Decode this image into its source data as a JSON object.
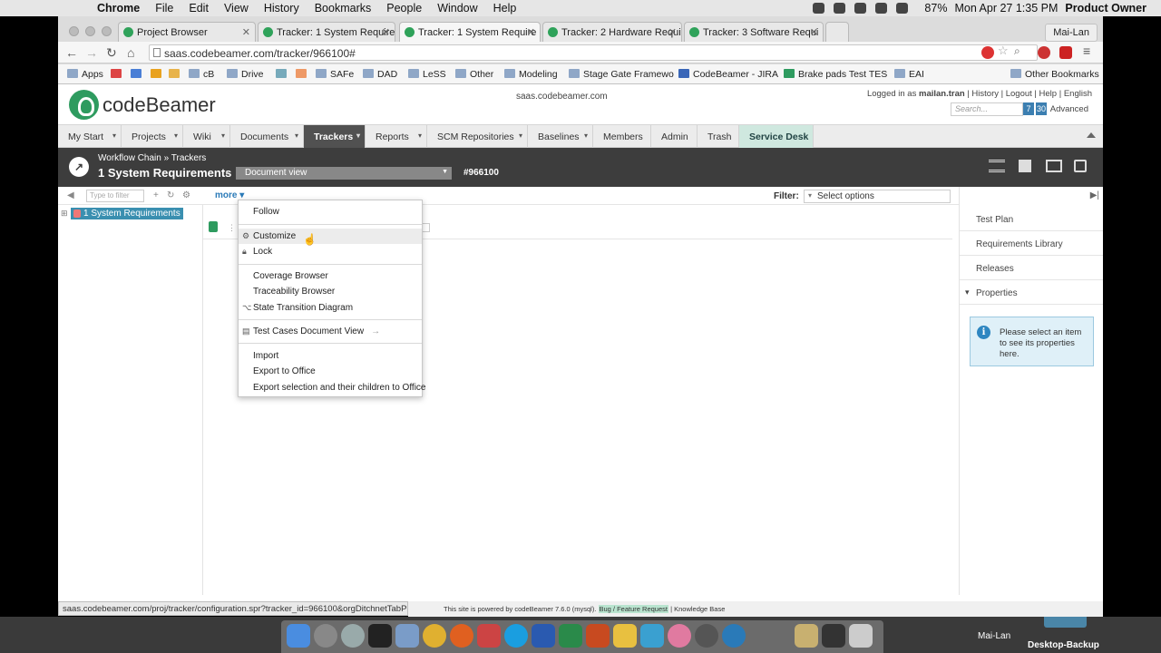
{
  "mac_menubar": {
    "app": "Chrome",
    "menus": [
      "File",
      "Edit",
      "View",
      "History",
      "Bookmarks",
      "People",
      "Window",
      "Help"
    ],
    "battery": "87%",
    "datetime": "Mon Apr 27  1:35 PM",
    "user": "Product Owner"
  },
  "browser": {
    "tabs": [
      {
        "label": "Project Browser",
        "active": false
      },
      {
        "label": "Tracker: 1 System Require",
        "active": false
      },
      {
        "label": "Tracker: 1 System Require",
        "active": true
      },
      {
        "label": "Tracker: 2 Hardware Requi",
        "active": false
      },
      {
        "label": "Tracker: 3 Software Requi",
        "active": false
      }
    ],
    "profile": "Mai-Lan",
    "url": "saas.codebeamer.com/tracker/966100#",
    "bookmarks": [
      "Apps",
      "cB",
      "Drive",
      "SAFe",
      "DAD",
      "LeSS",
      "Other",
      "Modeling",
      "Stage Gate Framewo",
      "CodeBeamer - JIRA",
      "Brake pads Test TES",
      "EAI",
      "Other Bookmarks"
    ],
    "status_url": "saas.codebeamer.com/proj/tracker/configuration.spr?tracker_id=966100&orgDitchnetTabP"
  },
  "app": {
    "logo_text": "codeBeamer",
    "host": "saas.codebeamer.com",
    "logged_prefix": "Logged in as",
    "logged_user": "mailan.tran",
    "logged_links": "| History | Logout | Help | English",
    "search_placeholder": "Search...",
    "badges": [
      "7",
      "30"
    ],
    "advanced": "Advanced",
    "nav": [
      "My Start",
      "Projects",
      "Wiki",
      "Documents",
      "Trackers",
      "Reports",
      "SCM Repositories",
      "Baselines",
      "Members",
      "Admin",
      "Trash",
      "Service Desk"
    ],
    "active_nav": "Trackers",
    "breadcrumb": "Workflow Chain » Trackers",
    "tracker_title": "1 System Requirements",
    "view_select": "Document view",
    "tracker_id": "#966100",
    "filter_placeholder": "Type to filter",
    "more_label": "more",
    "filter_label": "Filter:",
    "filter_select": "Select options",
    "tree_item": "1 System Requirements",
    "more_menu": [
      "Follow",
      "Customize",
      "Lock",
      "Coverage Browser",
      "Traceability Browser",
      "State Transition Diagram",
      "Test Cases Document View",
      "Import",
      "Export to Office",
      "Export selection and their children to Office"
    ],
    "right_panel": [
      "Test Plan",
      "Requirements Library",
      "Releases",
      "Properties"
    ],
    "info_text": "Please select an item to see its properties here.",
    "footer_text": "This site is powered by codeBeamer 7.6.0 (mysql).",
    "footer_link1": "Bug / Feature Request",
    "footer_link2": "| Knowledge Base"
  },
  "desktop": {
    "label_user": "Mai-Lan",
    "label_backup": "Desktop-Backup"
  },
  "colors": {
    "brand_green": "#2e9b5f",
    "header_dark": "#3d3d3d",
    "active_nav": "#515151",
    "service_desk": "#cfe8df",
    "link_blue": "#2a7ab8",
    "info_bg": "#dff0f8"
  }
}
